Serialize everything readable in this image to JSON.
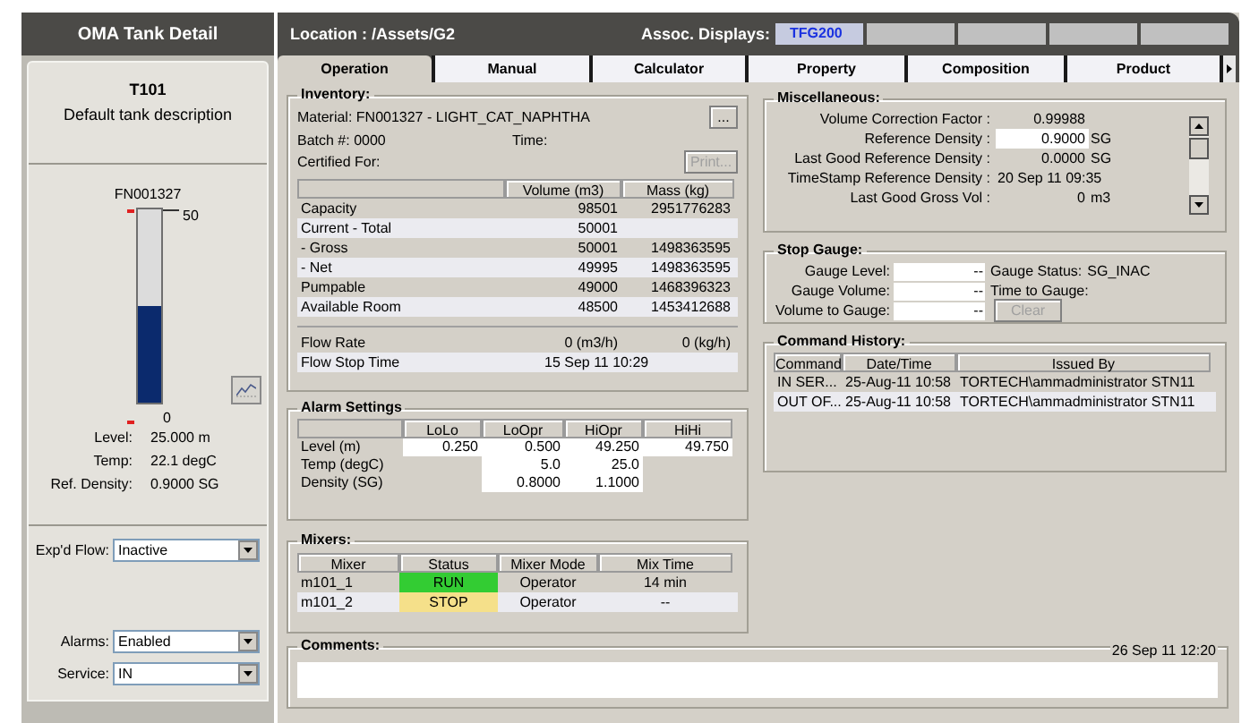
{
  "sidebar": {
    "title": "OMA Tank Detail",
    "tank_id": "T101",
    "description": "Default tank description",
    "material_code": "FN001327",
    "scale_max": "50",
    "scale_min": "0",
    "level": 0.5,
    "readings": [
      {
        "label": "Level:",
        "value": "25.000 m"
      },
      {
        "label": "Temp:",
        "value": "22.1 degC"
      },
      {
        "label": "Ref. Density:",
        "value": "0.9000 SG"
      }
    ],
    "dropdowns": [
      {
        "label": "Exp'd Flow:",
        "value": "Inactive"
      },
      {
        "label": "Alarms:",
        "value": "Enabled"
      },
      {
        "label": "Service:",
        "value": "IN"
      }
    ]
  },
  "header": {
    "location": "Location : /Assets/G2",
    "assoc_label": "Assoc. Displays:",
    "assoc_displays": [
      "TFG200"
    ]
  },
  "tabs": [
    {
      "label": "Operation",
      "selected": true
    },
    {
      "label": "Manual",
      "selected": false
    },
    {
      "label": "Calculator",
      "selected": false
    },
    {
      "label": "Property",
      "selected": false
    },
    {
      "label": "Composition",
      "selected": false
    },
    {
      "label": "Product",
      "selected": false
    }
  ],
  "inventory": {
    "title": "Inventory:",
    "material": "Material: FN001327 - LIGHT_CAT_NAPHTHA",
    "batch": "Batch #: 0000",
    "time_label": "Time:",
    "certified": "Certified For:",
    "more_button": "...",
    "print_button": {
      "label": "Print...",
      "disabled": true
    },
    "columns": [
      "Volume (m3)",
      "Mass (kg)"
    ],
    "rows": [
      {
        "label": "Capacity",
        "volume": "98501",
        "mass": "2951776283"
      },
      {
        "label": "Current - Total",
        "volume": "50001"
      },
      {
        "label": "- Gross",
        "volume": "50001",
        "mass": "1498363595"
      },
      {
        "label": "- Net",
        "volume": "49995",
        "mass": "1498363595"
      },
      {
        "label": "Pumpable",
        "volume": "49000",
        "mass": "1468396323"
      },
      {
        "label": "Available Room",
        "volume": "48500",
        "mass": "1453412688"
      }
    ],
    "flow_rate": {
      "label": "Flow Rate",
      "volume": "0 (m3/h)",
      "mass": "0 (kg/h)"
    },
    "flow_stop": {
      "label": "Flow Stop Time",
      "value": "15 Sep 11 10:29"
    }
  },
  "alarm_settings": {
    "title": "Alarm Settings",
    "columns": [
      "LoLo",
      "LoOpr",
      "HiOpr",
      "HiHi"
    ],
    "rows": [
      {
        "label": "Level (m)",
        "cells": [
          "0.250",
          "0.500",
          "49.250",
          "49.750"
        ]
      },
      {
        "label": "Temp (degC)",
        "cells": [
          null,
          "5.0",
          "25.0",
          null
        ]
      },
      {
        "label": "Density (SG)",
        "cells": [
          null,
          "0.8000",
          "1.1000",
          null
        ]
      }
    ]
  },
  "mixers": {
    "title": "Mixers:",
    "columns": [
      "Mixer",
      "Status",
      "Mixer Mode",
      "Mix Time"
    ],
    "rows": [
      {
        "mixer": "m101_1",
        "status": "RUN",
        "color": "#33cc33",
        "mode": "Operator",
        "mix_time": "14 min"
      },
      {
        "mixer": "m101_2",
        "status": "STOP",
        "color": "#f5e08a",
        "mode": "Operator",
        "mix_time": "--"
      }
    ]
  },
  "miscellaneous": {
    "title": "Miscellaneous:",
    "rows": [
      {
        "label": "Volume Correction Factor :",
        "value": "0.99988",
        "kind": "text"
      },
      {
        "label": "Reference Density :",
        "value": "0.9000",
        "unit": "SG",
        "kind": "field"
      },
      {
        "label": "Last Good Reference Density :",
        "value": "0.0000",
        "unit": "SG",
        "kind": "text"
      },
      {
        "label": "TimeStamp Reference Density :",
        "value": "20 Sep 11 09:35",
        "kind": "stamp"
      },
      {
        "label": "Last Good Gross Vol :",
        "value": "0",
        "unit": "m3",
        "kind": "text"
      }
    ]
  },
  "stop_gauge": {
    "title": "Stop Gauge:",
    "rows": [
      {
        "label": "Gauge Level:",
        "value": "--",
        "aside": {
          "kind": "text",
          "label": "Gauge Status:",
          "value": "SG_INAC"
        }
      },
      {
        "label": "Gauge Volume:",
        "value": "--",
        "aside": {
          "kind": "text",
          "label": "Time to Gauge:"
        }
      },
      {
        "label": "Volume to Gauge:",
        "value": "--",
        "aside": {
          "kind": "button",
          "label": "Clear",
          "disabled": true
        }
      }
    ]
  },
  "command_history": {
    "title": "Command History:",
    "columns": [
      "Command",
      "Date/Time",
      "Issued By"
    ],
    "rows": [
      {
        "command": "IN SER...",
        "time": "25-Aug-11 10:58",
        "issued_by": "TORTECH\\ammadministrator STN11"
      },
      {
        "command": "OUT OF...",
        "time": "25-Aug-11 10:58",
        "issued_by": "TORTECH\\ammadministrator STN11"
      }
    ]
  },
  "comments": {
    "title": "Comments:",
    "timestamp": "26 Sep 11 12:20"
  }
}
